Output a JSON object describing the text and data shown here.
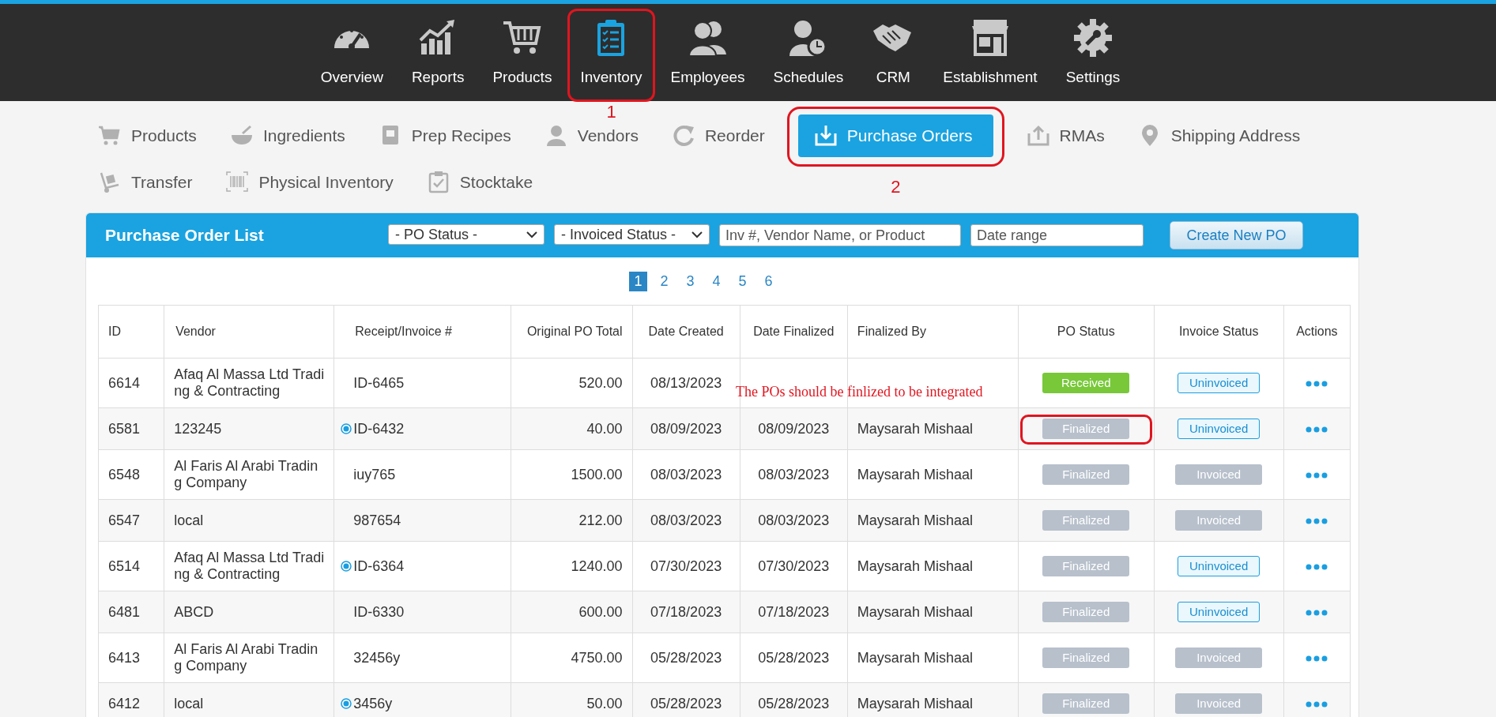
{
  "main_nav": [
    {
      "label": "Overview",
      "selected": false,
      "highlighted": false
    },
    {
      "label": "Reports",
      "selected": false,
      "highlighted": false
    },
    {
      "label": "Products",
      "selected": false,
      "highlighted": false
    },
    {
      "label": "Inventory",
      "selected": true,
      "highlighted": true,
      "marker": "1"
    },
    {
      "label": "Employees",
      "selected": false,
      "highlighted": false
    },
    {
      "label": "Schedules",
      "selected": false,
      "highlighted": false
    },
    {
      "label": "CRM",
      "selected": false,
      "highlighted": false
    },
    {
      "label": "Establishment",
      "selected": false,
      "highlighted": false
    },
    {
      "label": "Settings",
      "selected": false,
      "highlighted": false
    }
  ],
  "sub_nav": [
    {
      "label": "Products",
      "selected": false,
      "highlighted": false
    },
    {
      "label": "Ingredients",
      "selected": false,
      "highlighted": false
    },
    {
      "label": "Prep Recipes",
      "selected": false,
      "highlighted": false
    },
    {
      "label": "Vendors",
      "selected": false,
      "highlighted": false
    },
    {
      "label": "Reorder",
      "selected": false,
      "highlighted": false
    },
    {
      "label": "Purchase Orders",
      "selected": true,
      "highlighted": true,
      "marker": "2"
    },
    {
      "label": "RMAs",
      "selected": false,
      "highlighted": false
    },
    {
      "label": "Shipping Address",
      "selected": false,
      "highlighted": false
    },
    {
      "label": "Transfer",
      "selected": false,
      "highlighted": false
    },
    {
      "label": "Physical Inventory",
      "selected": false,
      "highlighted": false
    },
    {
      "label": "Stocktake",
      "selected": false,
      "highlighted": false
    }
  ],
  "panel": {
    "title": "Purchase Order List",
    "filters": [
      {
        "kind": "dropdown",
        "value": "- PO Status -"
      },
      {
        "kind": "dropdown",
        "value": "- Invoiced Status -"
      },
      {
        "kind": "text",
        "placeholder": "Inv #, Vendor Name, or Product"
      },
      {
        "kind": "text",
        "placeholder": "Date range"
      }
    ],
    "create_button": "Create New PO",
    "pages": [
      {
        "label": "1",
        "selected": true
      },
      {
        "label": "2",
        "selected": false
      },
      {
        "label": "3",
        "selected": false
      },
      {
        "label": "4",
        "selected": false
      },
      {
        "label": "5",
        "selected": false
      },
      {
        "label": "6",
        "selected": false
      }
    ]
  },
  "table": {
    "columns": [
      "ID",
      "Vendor",
      "Receipt/Invoice #",
      "Original PO Total",
      "Date Created",
      "Date Finalized",
      "Finalized By",
      "PO Status",
      "Invoice Status",
      "Actions"
    ],
    "rows": [
      {
        "id": "6614",
        "vendor": "Afaq Al Massa Ltd Trading & Contracting",
        "receipt": "ID-6465",
        "marked": false,
        "total": "520.00",
        "created": "08/13/2023",
        "finalized": "",
        "finalized_by": "",
        "po_status": {
          "text": "Received",
          "kind": "received",
          "highlighted": false
        },
        "invoice_status": {
          "text": "Uninvoiced",
          "kind": "uninvoiced"
        }
      },
      {
        "id": "6581",
        "vendor": "123245",
        "receipt": "ID-6432",
        "marked": true,
        "total": "40.00",
        "created": "08/09/2023",
        "finalized": "08/09/2023",
        "finalized_by": "Maysarah Mishaal",
        "po_status": {
          "text": "Finalized",
          "kind": "finalized",
          "highlighted": true
        },
        "invoice_status": {
          "text": "Uninvoiced",
          "kind": "uninvoiced"
        }
      },
      {
        "id": "6548",
        "vendor": "Al Faris Al Arabi Trading Company",
        "receipt": "iuy765",
        "marked": false,
        "total": "1500.00",
        "created": "08/03/2023",
        "finalized": "08/03/2023",
        "finalized_by": "Maysarah Mishaal",
        "po_status": {
          "text": "Finalized",
          "kind": "finalized",
          "highlighted": false
        },
        "invoice_status": {
          "text": "Invoiced",
          "kind": "invoiced"
        }
      },
      {
        "id": "6547",
        "vendor": "local",
        "receipt": "987654",
        "marked": false,
        "total": "212.00",
        "created": "08/03/2023",
        "finalized": "08/03/2023",
        "finalized_by": "Maysarah Mishaal",
        "po_status": {
          "text": "Finalized",
          "kind": "finalized",
          "highlighted": false
        },
        "invoice_status": {
          "text": "Invoiced",
          "kind": "invoiced"
        }
      },
      {
        "id": "6514",
        "vendor": "Afaq Al Massa Ltd Trading & Contracting",
        "receipt": "ID-6364",
        "marked": true,
        "total": "1240.00",
        "created": "07/30/2023",
        "finalized": "07/30/2023",
        "finalized_by": "Maysarah Mishaal",
        "po_status": {
          "text": "Finalized",
          "kind": "finalized",
          "highlighted": false
        },
        "invoice_status": {
          "text": "Uninvoiced",
          "kind": "uninvoiced"
        }
      },
      {
        "id": "6481",
        "vendor": "ABCD",
        "receipt": "ID-6330",
        "marked": false,
        "total": "600.00",
        "created": "07/18/2023",
        "finalized": "07/18/2023",
        "finalized_by": "Maysarah Mishaal",
        "po_status": {
          "text": "Finalized",
          "kind": "finalized",
          "highlighted": false
        },
        "invoice_status": {
          "text": "Uninvoiced",
          "kind": "uninvoiced"
        }
      },
      {
        "id": "6413",
        "vendor": "Al Faris Al Arabi Trading Company",
        "receipt": "32456y",
        "marked": false,
        "total": "4750.00",
        "created": "05/28/2023",
        "finalized": "05/28/2023",
        "finalized_by": "Maysarah Mishaal",
        "po_status": {
          "text": "Finalized",
          "kind": "finalized",
          "highlighted": false
        },
        "invoice_status": {
          "text": "Invoiced",
          "kind": "invoiced"
        }
      },
      {
        "id": "6412",
        "vendor": "local",
        "receipt": "3456y",
        "marked": true,
        "total": "50.00",
        "created": "05/28/2023",
        "finalized": "05/28/2023",
        "finalized_by": "Maysarah Mishaal",
        "po_status": {
          "text": "Finalized",
          "kind": "finalized",
          "highlighted": false
        },
        "invoice_status": {
          "text": "Invoiced",
          "kind": "invoiced"
        }
      }
    ]
  },
  "annotation_note": "The POs should be finlized to be integrated"
}
